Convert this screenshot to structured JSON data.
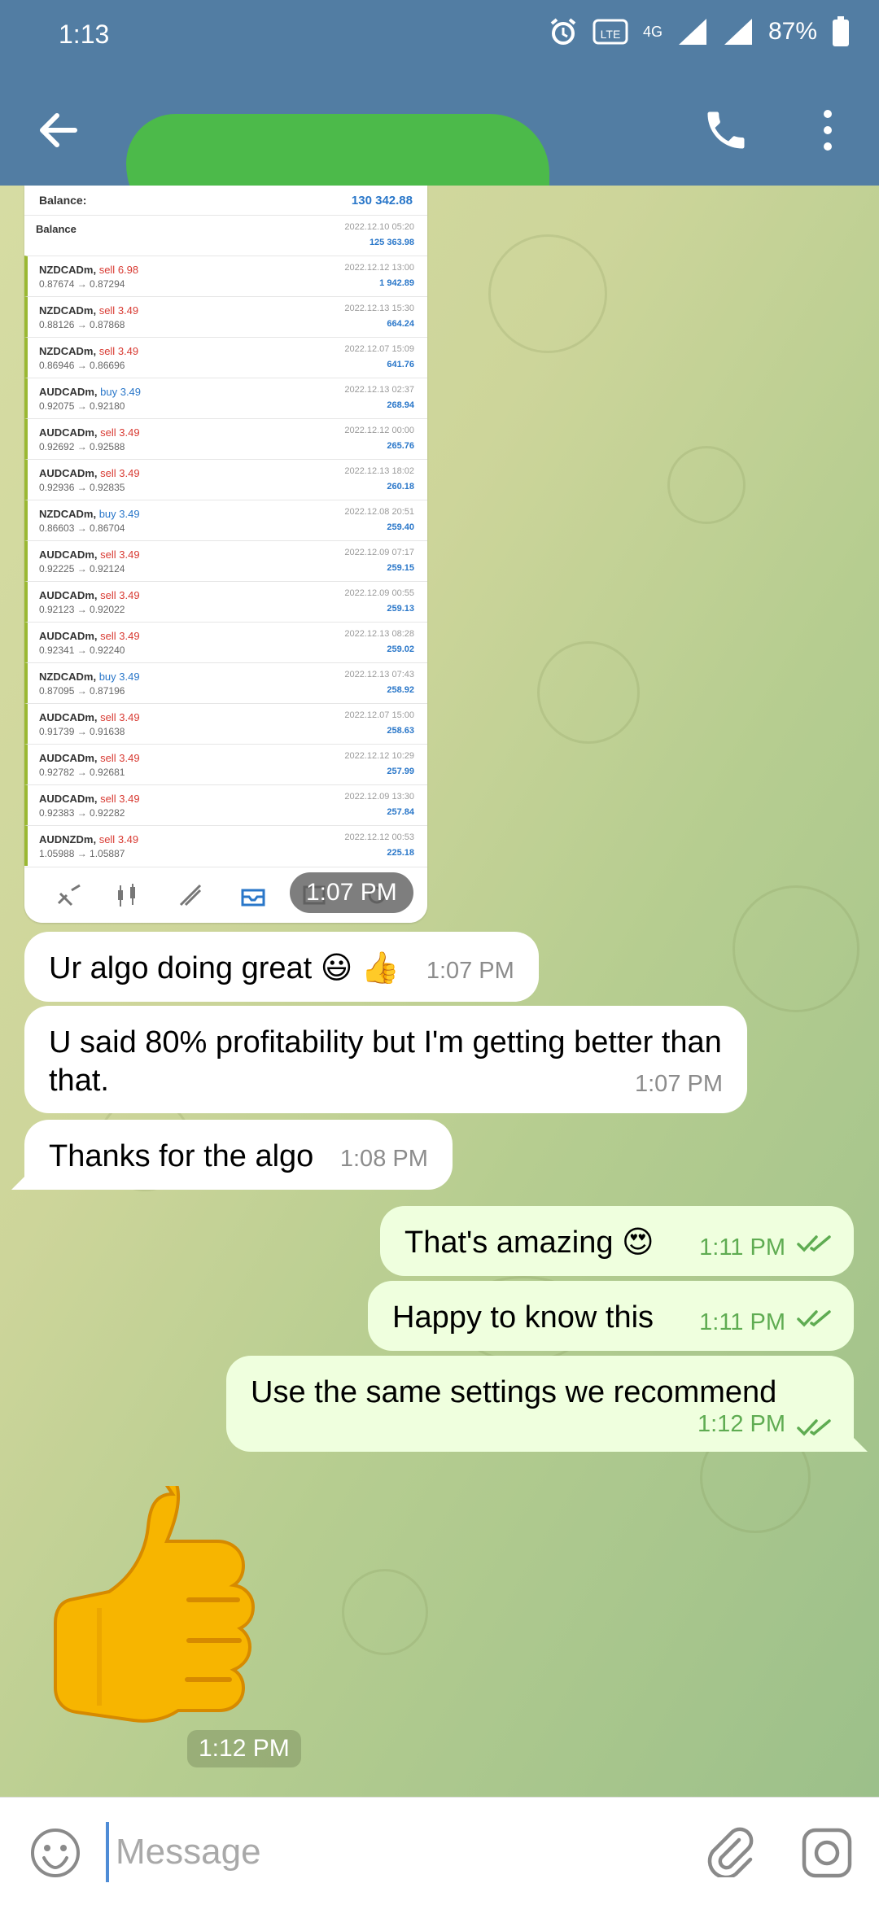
{
  "status_bar": {
    "time": "1:13",
    "network": "4G",
    "battery": "87%"
  },
  "header": {
    "back_icon": "arrow-left-icon",
    "call_icon": "phone-icon",
    "more_icon": "more-vertical-icon"
  },
  "screenshot": {
    "balance_top_label": "Balance:",
    "balance_top_value": "130 342.88",
    "balance_row": {
      "label": "Balance",
      "date": "2022.12.10 05:20",
      "value": "125 363.98"
    },
    "trades": [
      {
        "symbol": "NZDCADm,",
        "side": "sell",
        "lots": "6.98",
        "prices": "0.87674 → 0.87294",
        "date": "2022.12.12 13:00",
        "profit": "1 942.89"
      },
      {
        "symbol": "NZDCADm,",
        "side": "sell",
        "lots": "3.49",
        "prices": "0.88126 → 0.87868",
        "date": "2022.12.13 15:30",
        "profit": "664.24"
      },
      {
        "symbol": "NZDCADm,",
        "side": "sell",
        "lots": "3.49",
        "prices": "0.86946 → 0.86696",
        "date": "2022.12.07 15:09",
        "profit": "641.76"
      },
      {
        "symbol": "AUDCADm,",
        "side": "buy",
        "lots": "3.49",
        "prices": "0.92075 → 0.92180",
        "date": "2022.12.13 02:37",
        "profit": "268.94"
      },
      {
        "symbol": "AUDCADm,",
        "side": "sell",
        "lots": "3.49",
        "prices": "0.92692 → 0.92588",
        "date": "2022.12.12 00:00",
        "profit": "265.76"
      },
      {
        "symbol": "AUDCADm,",
        "side": "sell",
        "lots": "3.49",
        "prices": "0.92936 → 0.92835",
        "date": "2022.12.13 18:02",
        "profit": "260.18"
      },
      {
        "symbol": "NZDCADm,",
        "side": "buy",
        "lots": "3.49",
        "prices": "0.86603 → 0.86704",
        "date": "2022.12.08 20:51",
        "profit": "259.40"
      },
      {
        "symbol": "AUDCADm,",
        "side": "sell",
        "lots": "3.49",
        "prices": "0.92225 → 0.92124",
        "date": "2022.12.09 07:17",
        "profit": "259.15"
      },
      {
        "symbol": "AUDCADm,",
        "side": "sell",
        "lots": "3.49",
        "prices": "0.92123 → 0.92022",
        "date": "2022.12.09 00:55",
        "profit": "259.13"
      },
      {
        "symbol": "AUDCADm,",
        "side": "sell",
        "lots": "3.49",
        "prices": "0.92341 → 0.92240",
        "date": "2022.12.13 08:28",
        "profit": "259.02"
      },
      {
        "symbol": "NZDCADm,",
        "side": "buy",
        "lots": "3.49",
        "prices": "0.87095 → 0.87196",
        "date": "2022.12.13 07:43",
        "profit": "258.92"
      },
      {
        "symbol": "AUDCADm,",
        "side": "sell",
        "lots": "3.49",
        "prices": "0.91739 → 0.91638",
        "date": "2022.12.07 15:00",
        "profit": "258.63"
      },
      {
        "symbol": "AUDCADm,",
        "side": "sell",
        "lots": "3.49",
        "prices": "0.92782 → 0.92681",
        "date": "2022.12.12 10:29",
        "profit": "257.99"
      },
      {
        "symbol": "AUDCADm,",
        "side": "sell",
        "lots": "3.49",
        "prices": "0.92383 → 0.92282",
        "date": "2022.12.09 13:30",
        "profit": "257.84"
      },
      {
        "symbol": "AUDNZDm,",
        "side": "sell",
        "lots": "3.49",
        "prices": "1.05988 → 1.05887",
        "date": "2022.12.12 00:53",
        "profit": "225.18"
      }
    ],
    "toolbar_icons": [
      "quotes-icon",
      "chart-candles-icon",
      "trade-icon",
      "history-icon",
      "messages-icon",
      "settings-icon"
    ],
    "time": "1:07 PM"
  },
  "messages": [
    {
      "text": "Ur algo doing great 😃 👍",
      "time": "1:07 PM",
      "dir": "in"
    },
    {
      "text": "U said 80% profitability but I'm getting better than that.",
      "time": "1:07 PM",
      "dir": "in"
    },
    {
      "text": "Thanks for the algo",
      "time": "1:08 PM",
      "dir": "in"
    },
    {
      "text": "That's amazing 😍",
      "time": "1:11 PM",
      "dir": "out"
    },
    {
      "text": "Happy to know this",
      "time": "1:11 PM",
      "dir": "out"
    },
    {
      "text": "Use the same settings we recommend",
      "time": "1:12 PM",
      "dir": "out"
    }
  ],
  "sticker": {
    "icon": "thumbs-up-icon",
    "time": "1:12 PM"
  },
  "composer": {
    "placeholder": "Message",
    "emoji_icon": "smile-icon",
    "attach_icon": "paperclip-icon",
    "camera_icon": "camera-icon"
  },
  "colors": {
    "header": "#527da3",
    "outgoing_bubble": "#efffde",
    "check_marks": "#5fac52"
  }
}
